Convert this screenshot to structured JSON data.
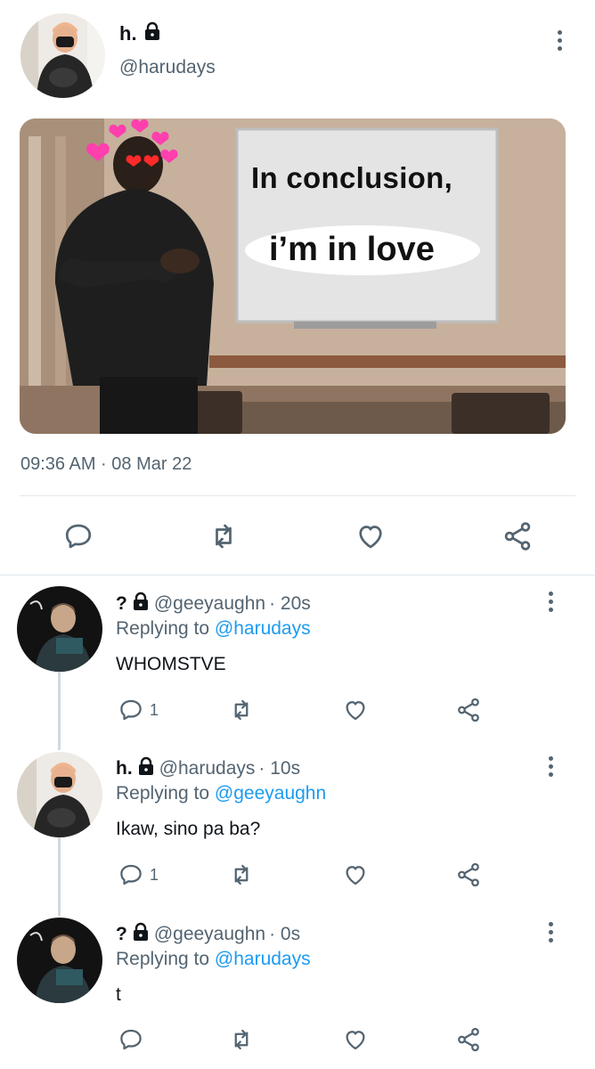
{
  "main_tweet": {
    "name": "h.",
    "handle": "@harudays",
    "meme_text_line1": "In conclusion,",
    "meme_text_line2": "i’m in love",
    "timestamp": "09:36 AM · 08 Mar 22"
  },
  "replies": [
    {
      "name": "?",
      "handle": "@geeyaughn",
      "age": "· 20s",
      "replying_label": "Replying to",
      "replying_to": "@harudays",
      "text": "WHOMSTVE",
      "reply_count": "1"
    },
    {
      "name": "h.",
      "handle": "@harudays",
      "age": "· 10s",
      "replying_label": "Replying to",
      "replying_to": "@geeyaughn",
      "text": "Ikaw, sino pa ba?",
      "reply_count": "1"
    },
    {
      "name": "?",
      "handle": "@geeyaughn",
      "age": "· 0s",
      "replying_label": "Replying to",
      "replying_to": "@harudays",
      "text": "t",
      "reply_count": ""
    }
  ],
  "colors": {
    "text": "#0f1419",
    "secondary": "#536471",
    "link": "#1d9bf0",
    "divider": "#e1e8ed"
  },
  "icons": [
    "lock-icon",
    "more-options-icon",
    "reply-icon",
    "retweet-icon",
    "like-icon",
    "share-icon"
  ]
}
